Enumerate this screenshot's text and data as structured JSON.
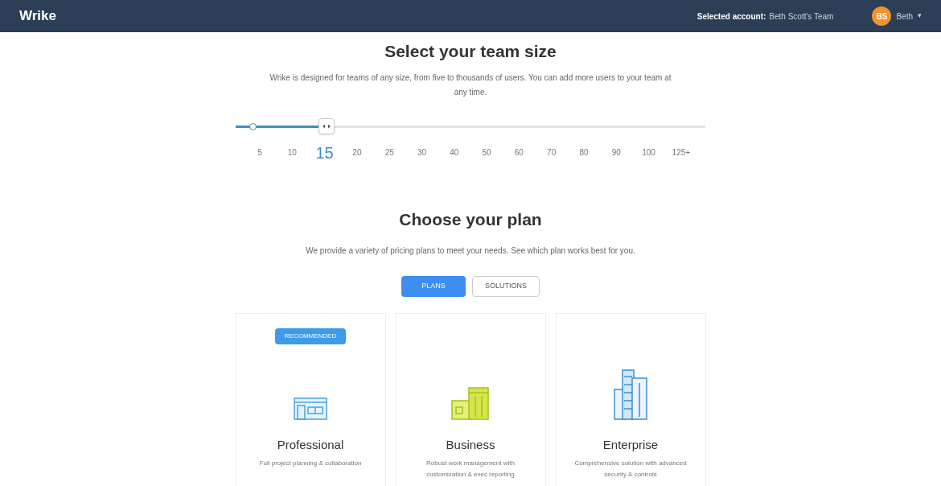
{
  "header": {
    "logo": "Wrike",
    "account_label": "Selected account:",
    "account_name": "Beth Scott's Team",
    "avatar_initials": "BS",
    "user_name": "Beth",
    "menu_caret": "▾"
  },
  "team_size": {
    "title": "Select your team size",
    "description": "Wrike is designed for teams of any size, from five to thousands of users. You can add more users to your team at any time.",
    "slider": {
      "level": 0.18
    },
    "ticks": [
      {
        "label": "5",
        "selected": false
      },
      {
        "label": "10",
        "selected": false
      },
      {
        "label": "15",
        "selected": true
      },
      {
        "label": "20",
        "selected": false
      },
      {
        "label": "25",
        "selected": false
      },
      {
        "label": "30",
        "selected": false
      },
      {
        "label": "40",
        "selected": false
      },
      {
        "label": "50",
        "selected": false
      },
      {
        "label": "60",
        "selected": false
      },
      {
        "label": "70",
        "selected": false
      },
      {
        "label": "80",
        "selected": false
      },
      {
        "label": "90",
        "selected": false
      },
      {
        "label": "100",
        "selected": false
      },
      {
        "label": "125+",
        "selected": false
      }
    ]
  },
  "plan": {
    "title": "Choose your plan",
    "description": "We provide a variety of pricing plans to meet your needs. See which plan works best for you.",
    "tabs": [
      {
        "label": "PLANS",
        "selected": true
      },
      {
        "label": "SOLUTIONS",
        "selected": false
      }
    ],
    "cards": [
      {
        "kind": "professional",
        "badge": "RECOMMENDED",
        "name": "Professional",
        "description": "Full project planning & collaboration"
      },
      {
        "kind": "business",
        "name": "Business",
        "description": "Robust work management with customization & exec reporting"
      },
      {
        "kind": "enterprise",
        "name": "Enterprise",
        "description": "Comprehensive solution with advanced security & controls"
      }
    ]
  }
}
